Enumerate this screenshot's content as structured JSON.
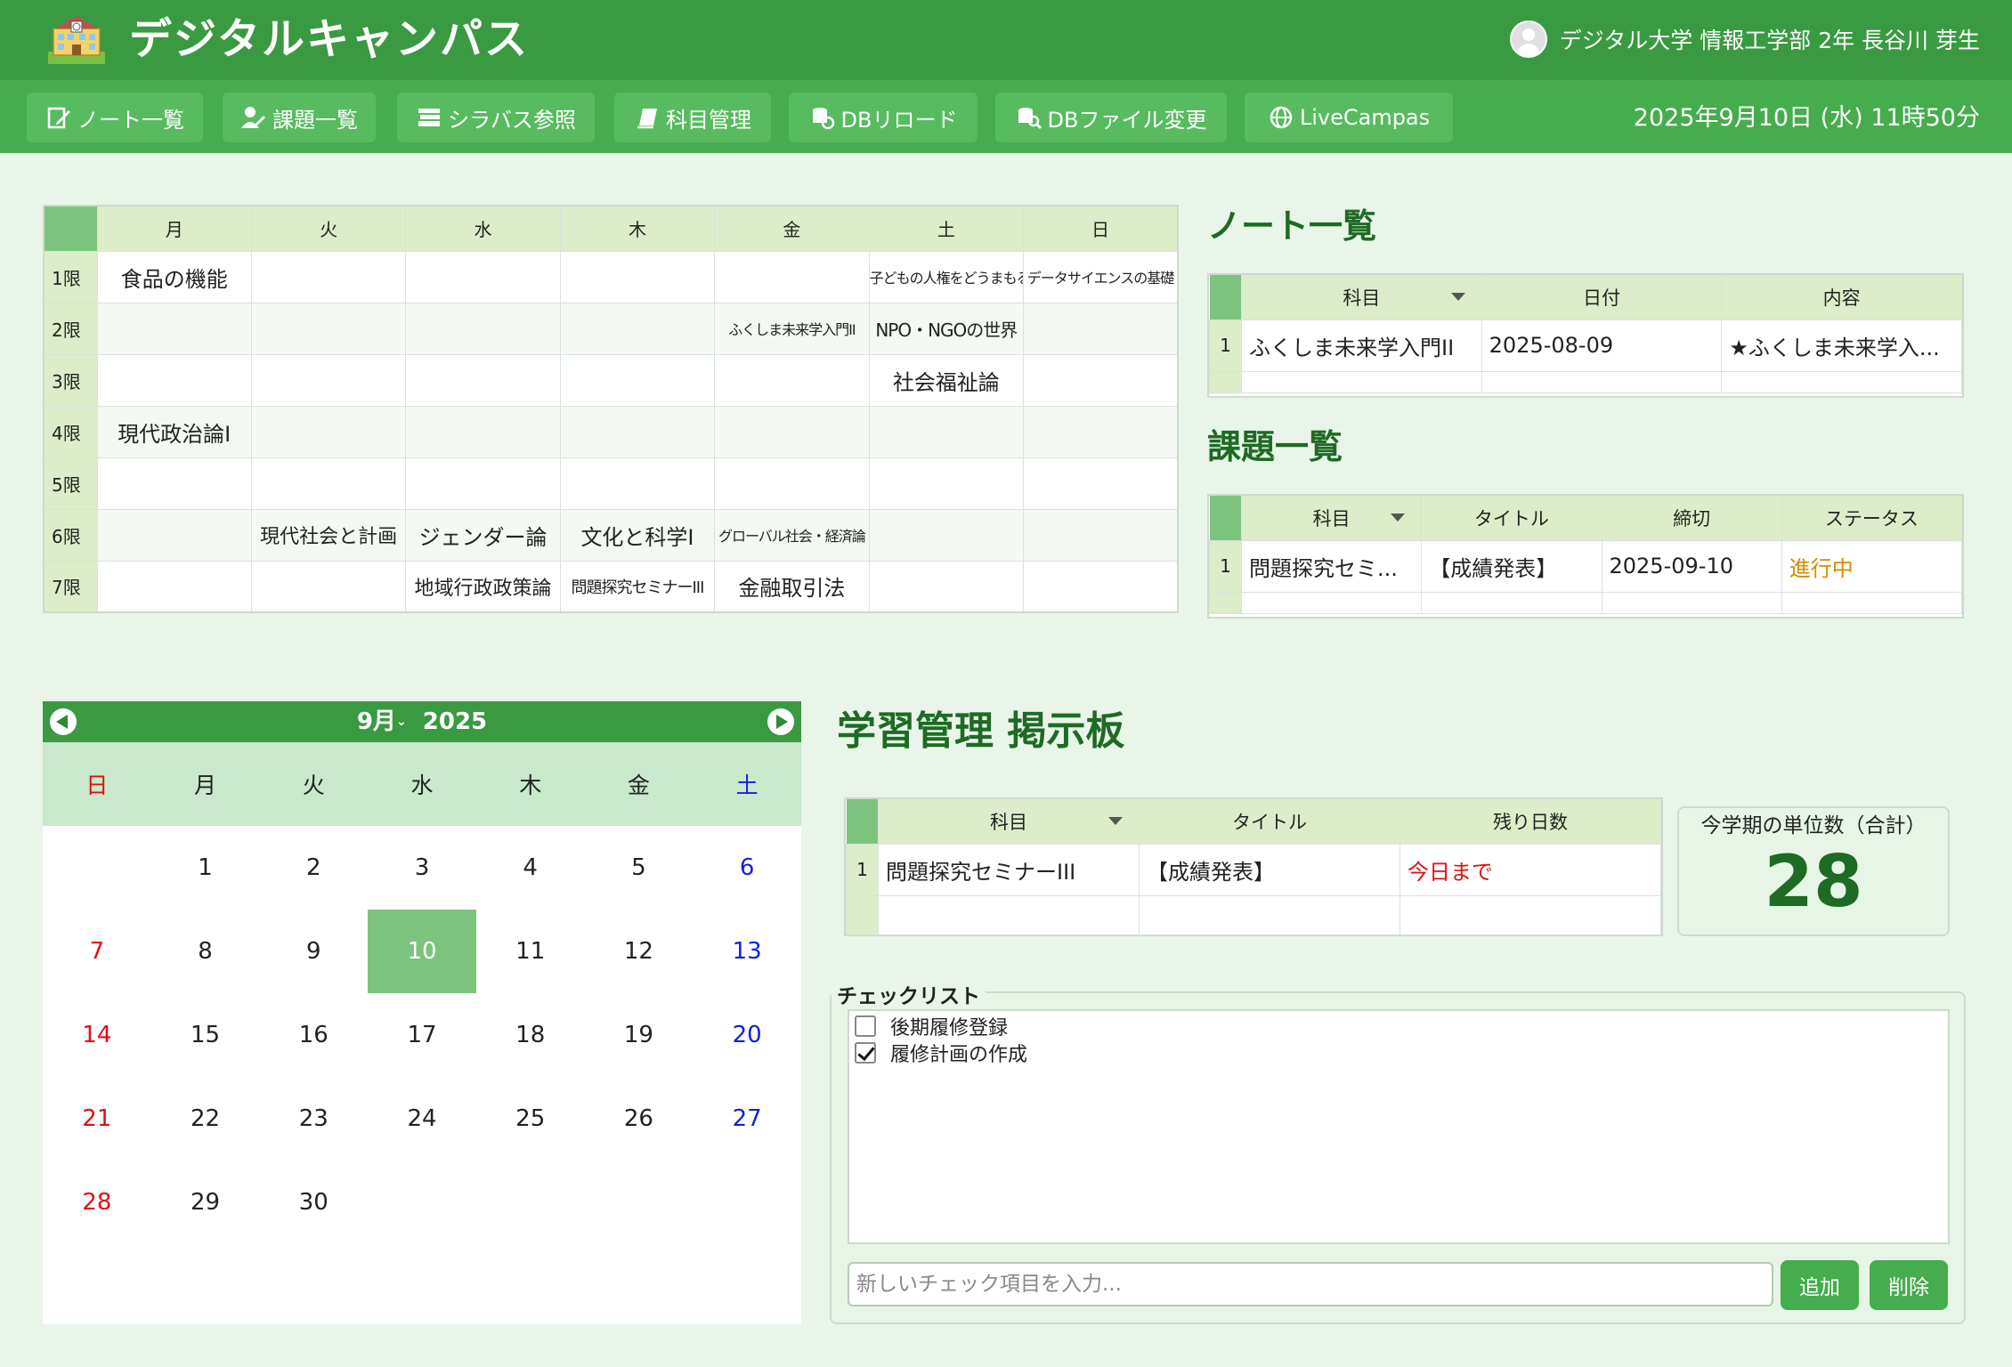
{
  "header": {
    "title": "デジタルキャンパス",
    "user": "デジタル大学 情報工学部 2年 長谷川 芽生",
    "datetime": "2025年9月10日 (水) 11時50分"
  },
  "nav": [
    {
      "label": "ノート一覧",
      "icon": "note-edit-icon"
    },
    {
      "label": "課題一覧",
      "icon": "user-edit-icon"
    },
    {
      "label": "シラバス参照",
      "icon": "books-icon"
    },
    {
      "label": "科目管理",
      "icon": "book-icon"
    },
    {
      "label": "DBリロード",
      "icon": "database-reload-icon"
    },
    {
      "label": "DBファイル変更",
      "icon": "database-search-icon"
    },
    {
      "label": "LiveCampas",
      "icon": "globe-icon"
    }
  ],
  "timetable": {
    "days": [
      "月",
      "火",
      "水",
      "木",
      "金",
      "土",
      "日"
    ],
    "periods": [
      "1限",
      "2限",
      "3限",
      "4限",
      "5限",
      "6限",
      "7限"
    ],
    "cells": [
      [
        "食品の機能",
        "",
        "",
        "",
        "",
        "子どもの人権をどうまもるか",
        "データサイエンスの基礎"
      ],
      [
        "",
        "",
        "",
        "",
        "ふくしま未来学入門II",
        "NPO・NGOの世界",
        ""
      ],
      [
        "",
        "",
        "",
        "",
        "",
        "社会福祉論",
        ""
      ],
      [
        "現代政治論I",
        "",
        "",
        "",
        "",
        "",
        ""
      ],
      [
        "",
        "",
        "",
        "",
        "",
        "",
        ""
      ],
      [
        "",
        "現代社会と計画",
        "ジェンダー論",
        "文化と科学I",
        "グローバル社会・経済論",
        "",
        ""
      ],
      [
        "",
        "",
        "地域行政政策論",
        "問題探究セミナーIII",
        "金融取引法",
        "",
        ""
      ]
    ]
  },
  "notes": {
    "title": "ノート一覧",
    "columns": [
      "科目",
      "日付",
      "内容"
    ],
    "rows": [
      {
        "num": "1",
        "subject": "ふくしま未来学入門II",
        "date": "2025-08-09",
        "content": "★ふくしま未来学入..."
      }
    ]
  },
  "tasks": {
    "title": "課題一覧",
    "columns": [
      "科目",
      "タイトル",
      "締切",
      "ステータス"
    ],
    "rows": [
      {
        "num": "1",
        "subject": "問題探究セミ...",
        "title": "【成績発表】",
        "deadline": "2025-09-10",
        "status": "進行中"
      }
    ]
  },
  "calendar": {
    "month": "9月",
    "year": "2025",
    "weekdays": [
      "日",
      "月",
      "火",
      "水",
      "木",
      "金",
      "土"
    ],
    "today": 10,
    "first_weekday_index": 1,
    "days_in_month": 30
  },
  "board": {
    "title": "学習管理 掲示板",
    "columns": [
      "科目",
      "タイトル",
      "残り日数"
    ],
    "rows": [
      {
        "num": "1",
        "subject": "問題探究セミナーIII",
        "title": "【成績発表】",
        "remaining": "今日まで"
      }
    ],
    "credits_label": "今学期の単位数（合計）",
    "credits_value": "28"
  },
  "checklist": {
    "legend": "チェックリスト",
    "items": [
      {
        "label": "後期履修登録",
        "checked": false
      },
      {
        "label": "履修計画の作成",
        "checked": true
      }
    ],
    "input_placeholder": "新しいチェック項目を入力...",
    "add_label": "追加",
    "delete_label": "削除"
  },
  "colors": {
    "header": "#3a9a42",
    "navbar": "#45ad4d",
    "accent_dark": "#1e6b24",
    "today": "#7cc47e",
    "status_in_progress": "#d98a00",
    "due_today": "#e01010"
  }
}
